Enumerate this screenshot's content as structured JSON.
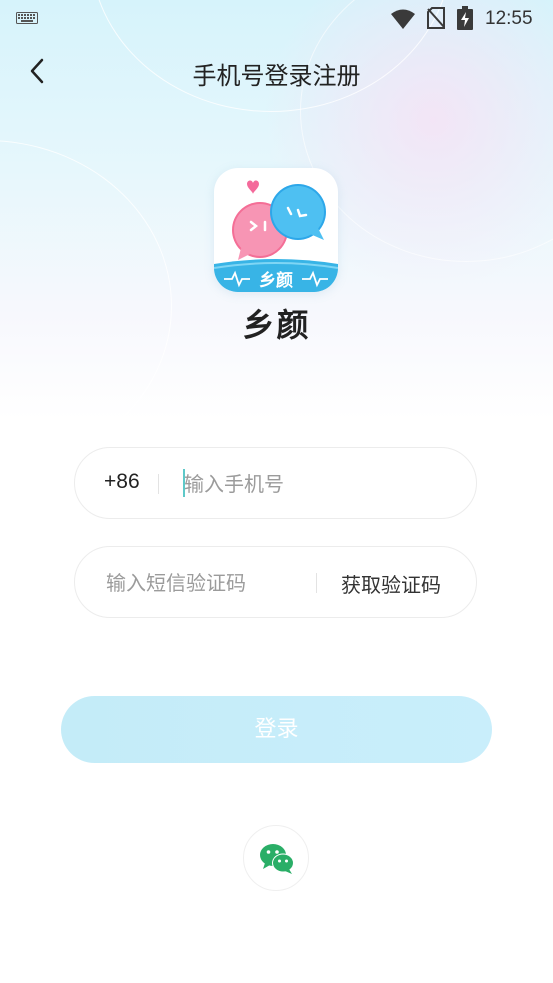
{
  "status_bar": {
    "time": "12:55",
    "icons": [
      "keyboard-icon",
      "wifi-icon",
      "no-sim-icon",
      "battery-charging-icon"
    ]
  },
  "header": {
    "back_icon": "chevron-left-icon",
    "title": "手机号登录注册"
  },
  "app": {
    "name": "乡颜",
    "logo_text": "乡颜"
  },
  "form": {
    "country_code": "+86",
    "phone_placeholder": "输入手机号",
    "phone_value": "",
    "code_placeholder": "输入短信验证码",
    "code_value": "",
    "get_code_label": "获取验证码",
    "login_label": "登录"
  },
  "social": {
    "wechat_icon": "wechat-icon"
  },
  "colors": {
    "accent": "#5ec9c9",
    "login_button": "#c6edf9",
    "wechat_green": "#2aae67"
  }
}
